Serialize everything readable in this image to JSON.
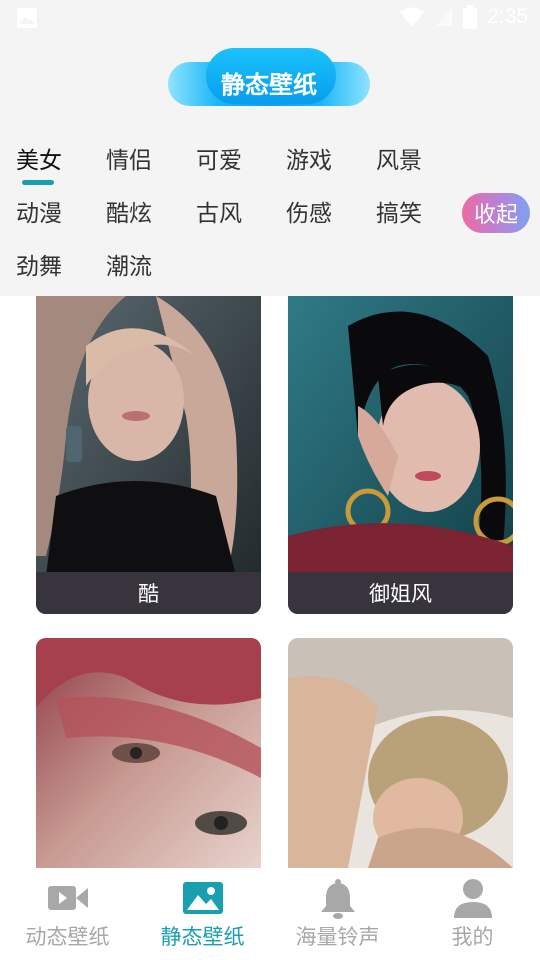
{
  "status_bar": {
    "time": "2:35"
  },
  "header": {
    "title": "静态壁纸"
  },
  "categories": [
    {
      "label": "美女",
      "active": true
    },
    {
      "label": "情侣"
    },
    {
      "label": "可爱"
    },
    {
      "label": "游戏"
    },
    {
      "label": "风景"
    },
    {
      "label": "动漫"
    },
    {
      "label": "酷炫"
    },
    {
      "label": "古风"
    },
    {
      "label": "伤感"
    },
    {
      "label": "搞笑"
    },
    {
      "label": "劲舞"
    },
    {
      "label": "潮流"
    }
  ],
  "collapse_label": "收起",
  "wallpapers": [
    {
      "caption": "酷"
    },
    {
      "caption": "御姐风"
    },
    {
      "caption": ""
    },
    {
      "caption": ""
    }
  ],
  "bottom_nav": [
    {
      "label": "动态壁纸",
      "icon": "video-camera-icon"
    },
    {
      "label": "静态壁纸",
      "icon": "image-icon",
      "active": true
    },
    {
      "label": "海量铃声",
      "icon": "bell-icon"
    },
    {
      "label": "我的",
      "icon": "person-icon"
    }
  ],
  "colors": {
    "accent": "#1a9fb0",
    "title_blue": "#0aa0ef",
    "caption_bg": "#37343d"
  }
}
